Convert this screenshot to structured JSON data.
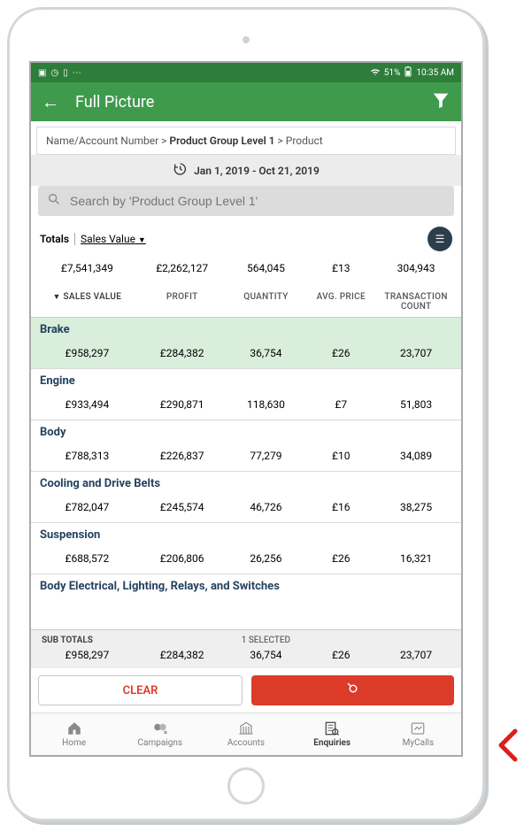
{
  "status": {
    "battery_pct": "51%",
    "time": "10:35 AM"
  },
  "header": {
    "title": "Full Picture"
  },
  "breadcrumb": {
    "a": "Name/Account Number",
    "b": "Product Group Level 1",
    "c": "Product"
  },
  "date_range": "Jan 1, 2019 - Oct 21, 2019",
  "search": {
    "placeholder": "Search by 'Product Group Level 1'"
  },
  "totals_bar": {
    "label": "Totals",
    "metric": "Sales Value"
  },
  "totals": {
    "sales_value": "£7,541,349",
    "profit": "£2,262,127",
    "quantity": "564,045",
    "avg_price": "£13",
    "txn_count": "304,943"
  },
  "columns": {
    "c1": "SALES VALUE",
    "c2": "PROFIT",
    "c3": "QUANTITY",
    "c4": "AVG. PRICE",
    "c5": "TRANSACTION COUNT"
  },
  "rows": [
    {
      "name": "Brake",
      "sales_value": "£958,297",
      "profit": "£284,382",
      "quantity": "36,754",
      "avg_price": "£26",
      "txn_count": "23,707",
      "selected": true
    },
    {
      "name": "Engine",
      "sales_value": "£933,494",
      "profit": "£290,871",
      "quantity": "118,630",
      "avg_price": "£7",
      "txn_count": "51,803",
      "selected": false
    },
    {
      "name": "Body",
      "sales_value": "£788,313",
      "profit": "£226,837",
      "quantity": "77,279",
      "avg_price": "£10",
      "txn_count": "34,089",
      "selected": false
    },
    {
      "name": "Cooling and Drive Belts",
      "sales_value": "£782,047",
      "profit": "£245,574",
      "quantity": "46,726",
      "avg_price": "£16",
      "txn_count": "38,275",
      "selected": false
    },
    {
      "name": "Suspension",
      "sales_value": "£688,572",
      "profit": "£206,806",
      "quantity": "26,256",
      "avg_price": "£26",
      "txn_count": "16,321",
      "selected": false
    },
    {
      "name": "Body Electrical, Lighting, Relays, and Switches",
      "sales_value": "",
      "profit": "",
      "quantity": "",
      "avg_price": "",
      "txn_count": "",
      "selected": false
    }
  ],
  "subtotals": {
    "label": "SUB TOTALS",
    "selected_label": "1 SELECTED",
    "sales_value": "£958,297",
    "profit": "£284,382",
    "quantity": "36,754",
    "avg_price": "£26",
    "txn_count": "23,707"
  },
  "actions": {
    "clear": "CLEAR"
  },
  "nav": {
    "home": "Home",
    "campaigns": "Campaigns",
    "accounts": "Accounts",
    "enquiries": "Enquiries",
    "mycalls": "MyCalls"
  }
}
